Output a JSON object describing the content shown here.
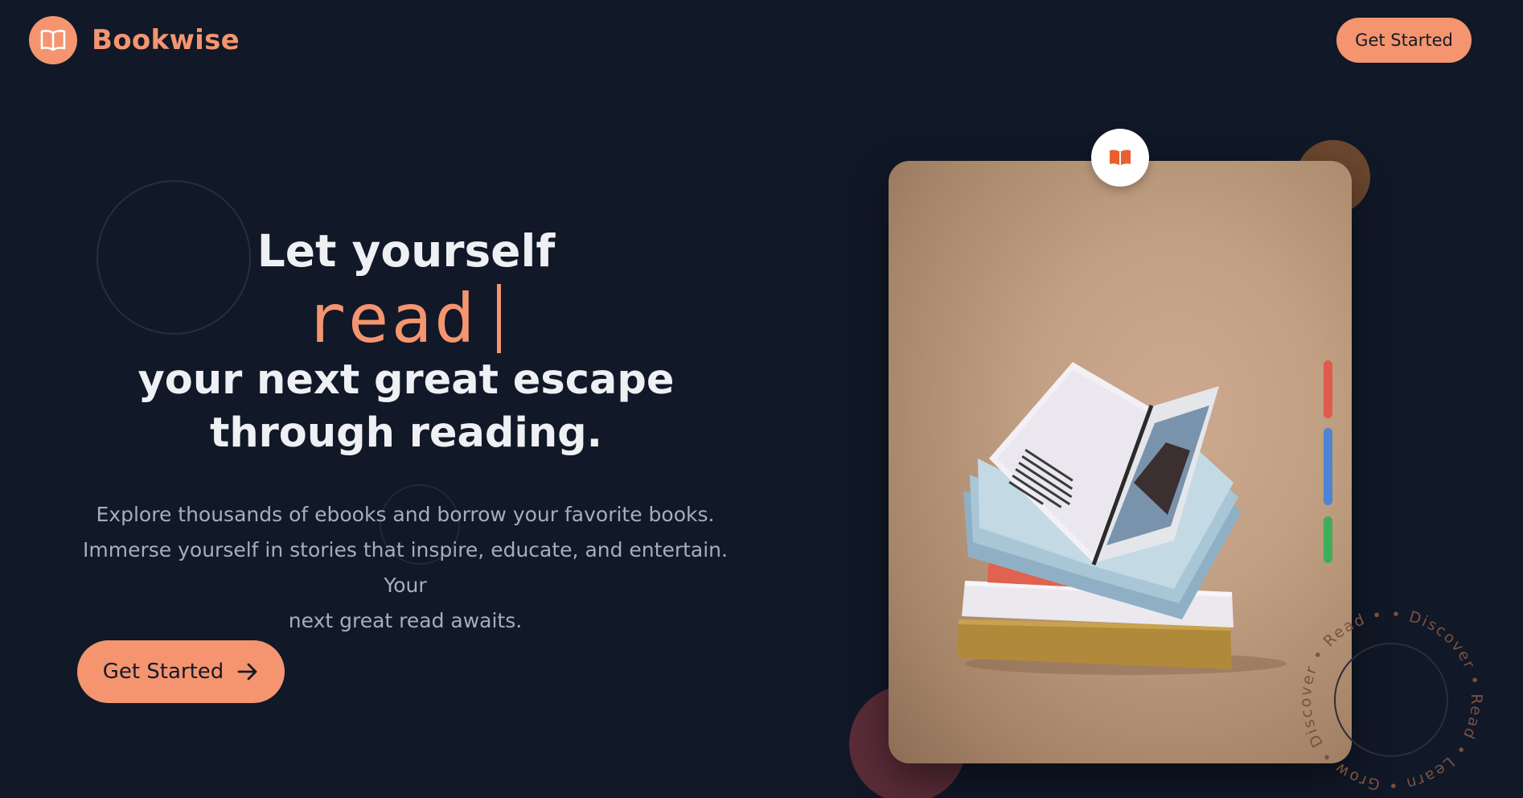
{
  "header": {
    "brand": "Bookwise",
    "cta_label": "Get Started",
    "logo_icon": "open-book-icon"
  },
  "hero": {
    "line1": "Let yourself",
    "typed_word": "read",
    "line3": "your next great escape",
    "line4": "through reading.",
    "subtitle_line1": "Explore thousands of ebooks and borrow your favorite books.",
    "subtitle_line2": "Immerse yourself in stories that inspire, educate, and entertain. Your",
    "subtitle_line3": "next great read awaits.",
    "cta_label": "Get Started",
    "cta_icon": "arrow-right-icon"
  },
  "visual": {
    "badge_icon": "book-open-icon",
    "ring_text": "• Discover • Read • Learn • Grow • Discover • Read • Learn • Grow",
    "indicator_colors": [
      "#e05a4f",
      "#4f84d4",
      "#3fae5a"
    ]
  },
  "colors": {
    "background": "#111827",
    "accent": "#f4956f",
    "text": "#eef0f4",
    "muted": "#a6adbb"
  }
}
